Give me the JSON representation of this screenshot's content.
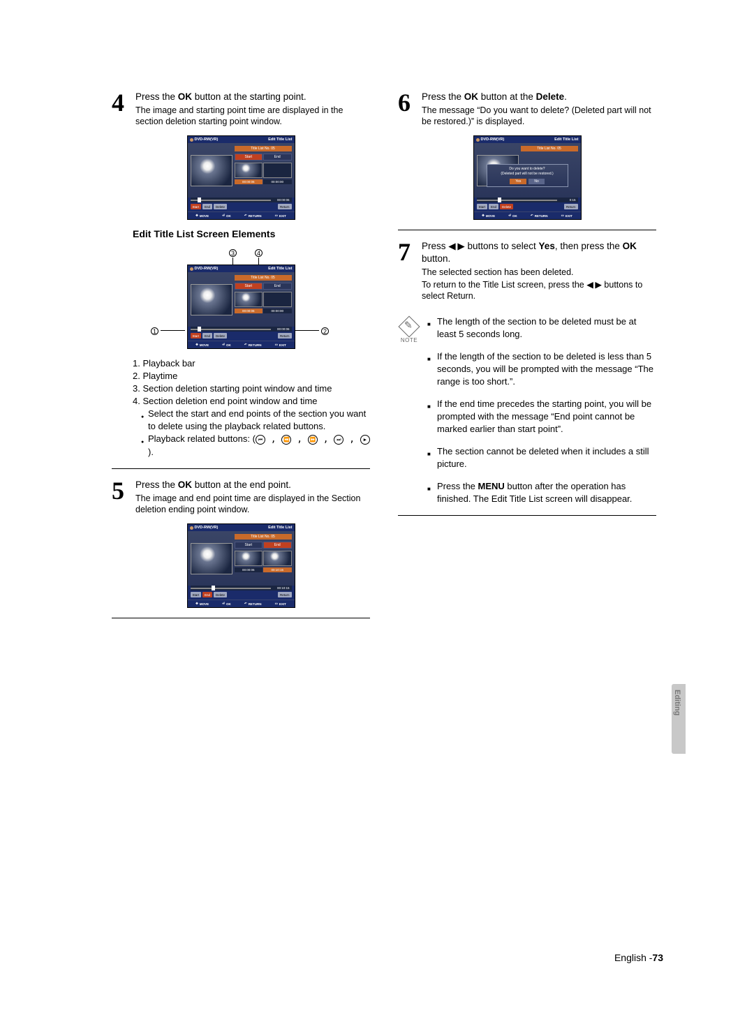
{
  "step4": {
    "main_a": "Press the ",
    "main_b": "OK",
    "main_c": " button at the starting point.",
    "sub": "The image and starting point time are displayed in the section deletion starting point window."
  },
  "step5": {
    "main_a": "Press the ",
    "main_b": "OK",
    "main_c": " button at the end point.",
    "sub": "The image and end point time are displayed in the Section deletion ending point window."
  },
  "step6": {
    "main_a": "Press the ",
    "main_b": "OK",
    "main_c": " button at the ",
    "main_d": "Delete",
    "main_e": ".",
    "sub": "The message “Do you want to delete? (Deleted part will not be restored.)” is displayed."
  },
  "step7": {
    "main_a": "Press ◀ ▶ buttons to select ",
    "main_b": "Yes",
    "main_c": ", then press the ",
    "main_d": "OK",
    "main_e": " button.",
    "sub1": "The selected section has been deleted.",
    "sub2": "To return to the Title List screen, press the ◀ ▶ buttons to select Return."
  },
  "elements_heading": "Edit Title List Screen Elements",
  "elements_list": {
    "i1": "1. Playback bar",
    "i2": "2. Playtime",
    "i3": "3. Section deletion starting point window and time",
    "i4": "4. Section deletion end point window and time",
    "b1": "Select the start and end points of the section you want to delete using the playback related buttons.",
    "b2a": "Playback related buttons: (",
    "b2b": ")."
  },
  "notes": {
    "n1": "The length of the section to be deleted must be at least 5 seconds long.",
    "n2": "If the length of the section to be deleted is less than 5 seconds, you will be prompted with the message “The range is too short.”.",
    "n3": "If the end time precedes the starting point, you will be prompted with the message “End point cannot be marked earlier than start point”.",
    "n4": "The section cannot be deleted when it includes a still picture.",
    "n5a": "Press the ",
    "n5b": "MENU",
    "n5c": " button after the operation has finished. The Edit Title List screen will disappear."
  },
  "note_label": "NOTE",
  "fig": {
    "disc_label": "DVD-RW(VR)",
    "title": "Edit Title List",
    "title_list_no": "Title List No. 05",
    "start": "Start",
    "end": "End",
    "delete": "Delete",
    "return": "Return",
    "t_start": "00:00:06",
    "t_end_blank": "00:00:00",
    "t_end_5": "00:10:15",
    "pbar_t4": "00:00:06",
    "pbar_t5": "00:10:15",
    "pbar_t6": "0:15",
    "nav_move": "MOVE",
    "nav_ok": "OK",
    "nav_return": "RETURN",
    "nav_exit": "EXIT",
    "dialog_l1": "Do you want to delete?",
    "dialog_l2": "(Deleted part will not be restored.)",
    "yes": "Yes",
    "no": "No"
  },
  "sidetab": "Editing",
  "footer_lang": "English -",
  "footer_page": "73"
}
